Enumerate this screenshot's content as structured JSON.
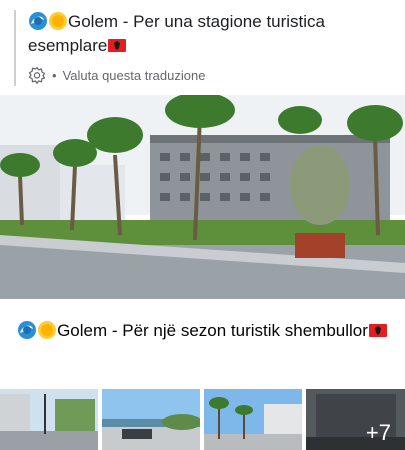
{
  "post": {
    "translated_title": "Golem - Per una stagione turistica esemplare",
    "translation_link": "Valuta questa traduzione",
    "original_title": "Golem - Për një sezon turistik shembullor",
    "more_photos": "+7"
  },
  "icons": {
    "wave": "wave-emoji-icon",
    "sun": "sun-emoji-icon",
    "flag": "albania-flag-icon",
    "gear": "gear-icon"
  },
  "colors": {
    "flag_red": "#e41e20",
    "muted_text": "#65676b"
  }
}
